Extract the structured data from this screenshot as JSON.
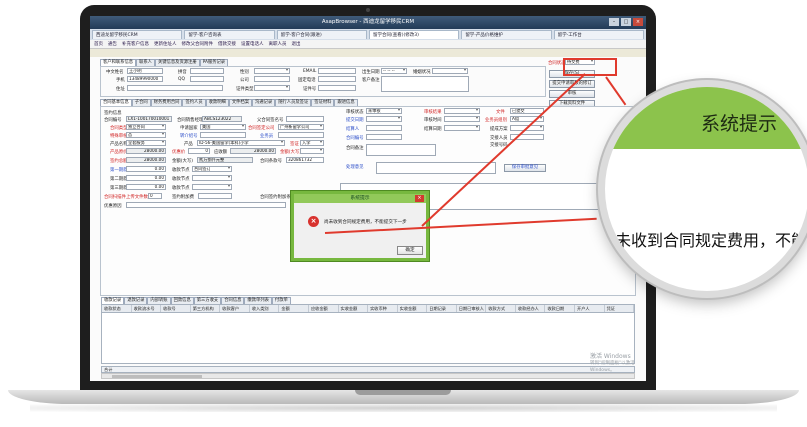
{
  "window": {
    "title": "AsapBrowser - 西迪龙留学移民CRM",
    "buttons": [
      "–",
      "□",
      "×"
    ]
  },
  "browser_tabs": [
    {
      "label": "西迪龙留学移民CRM",
      "active": false
    },
    {
      "label": "留学-客户咨询表",
      "active": false
    },
    {
      "label": "留学-客户合同(跟进)",
      "active": false
    },
    {
      "label": "留学合同(查看)(修改3)",
      "active": true
    },
    {
      "label": "留学-产品价格维护",
      "active": false
    },
    {
      "label": "留学-工作台",
      "active": false
    }
  ],
  "menu": [
    "首页",
    "通告",
    "补充客户信息",
    "更新住址人",
    "修改父合同附件",
    "借款交接",
    "设置电话人",
    "离职人员",
    "退出"
  ],
  "toolbar": [
    "客户和联系信息",
    "联系人",
    "关键信息及资源注册",
    "PA服务记录"
  ],
  "customer": {
    "name_label": "中文姓名",
    "name_value": "王小明",
    "mobile_label": "手机",
    "mobile_value": "13489990000",
    "address_label": "住址",
    "pinyin_label": "拼音",
    "qq_label": "QQ",
    "gender_label": "性别",
    "company_label": "公司",
    "cert_type_label": "证件类型",
    "email_label": "EMAIL",
    "phone_label": "固定电话",
    "cert_no_label": "证件号",
    "birth_label": "出生日期",
    "birth_value": "-- -- --",
    "marital_label": "婚姻状况",
    "remark_label": "客户备注",
    "contract_type_label": "合同状态",
    "contract_type_value": "待交费"
  },
  "right_buttons": [
    "保存(S)",
    "提交申请审核的修订",
    "审核",
    "下载资料文件"
  ],
  "contract_tabs": [
    "合同基本信息",
    "子合同",
    "财务费用合同",
    "签约人员",
    "收款明细",
    "文件档案",
    "沟通记录",
    "随行人员及签证",
    "签证材料",
    "跟进信息"
  ],
  "contract": {
    "sign_label": "签约信息",
    "no_label": "合同编号",
    "no_value": "LX1-100170010001",
    "sales_label": "合同销售经理",
    "sales_value": "ABCS123022",
    "parent_label": "父合同签名号",
    "customer_type_label": "合同类型",
    "customer_type_value": "独立合同",
    "country_label": "申请国家",
    "country_value": "美国",
    "school_label": "合同签定公司",
    "school_value": "广州新留学公司",
    "special_label": "特殊审核",
    "special_value": "否",
    "intro_label": "转介绍号",
    "product_label": "产品名称",
    "product_value": "全套服务",
    "product2_label": "产品",
    "product2_value": "ID-56-美国留学(本科)小学",
    "visa_label": "签证",
    "visa_value": "入学",
    "price_label": "产品原价",
    "price_value": "28000.00",
    "discount_label": "优惠价",
    "discount_value": "0",
    "fee_label": "应收额",
    "fee_value": "28000.00",
    "agreed_label": "签约总额",
    "agreed_value": "28000.00",
    "received_label": "金额(大写)",
    "received_value": "贰万捌仟元整",
    "rule_label": "合同条款号",
    "rule_value": "320861732",
    "first_label": "第一期款",
    "first_value": "0.00",
    "second_label": "第二期款",
    "second_value": "0.00",
    "third_label": "第三期款",
    "third_value": "0.00",
    "paynode_label": "收款节点",
    "paynode_value": "合同签订",
    "upload_label": "合同扫描件上传文件数",
    "upload_value": "0",
    "attach_label": "签约附加费",
    "remark_label": "合同签约附加条款",
    "other_label": "其他备注",
    "status_label": "审核状态",
    "status_value": "未审核",
    "audit_label": "审核结果",
    "audit_time_label": "审核时间",
    "submit_label": "提交日期",
    "settle_label": "结算人",
    "settle_date_label": "结算日期",
    "contract_no_label": "合同编号",
    "contract_remark_label": "合同备注",
    "sales_name_label": "业务员",
    "doc_label": "文件",
    "doc_value": "已提交",
    "sale_manager_label": "业务员组别",
    "sale_manager_value": "A组",
    "commission_label": "提成方案",
    "handover_label": "交接人员",
    "handover_no_label": "交接号码",
    "review_label": "处理意见",
    "review_btn": "保存审批意见",
    "extra_label": "优惠原因"
  },
  "bottom_tabs": [
    "收款记录",
    "退款记录",
    "内部转账",
    "回款信息",
    "第三方收支",
    "合同信息",
    "缴款单列表",
    "付款单"
  ],
  "grid_columns": [
    "收款状态",
    "收款流水号",
    "收款号",
    "第三方机构",
    "收款客户",
    "收入类别",
    "金额",
    "应收金额",
    "实收金额",
    "实收币种",
    "实收金额",
    "日期记录",
    "日期已审核人",
    "收款方式",
    "收款经办人",
    "收款日期",
    "开户人",
    "凭证"
  ],
  "summary_label": "合计",
  "watermark": {
    "line1": "激活 Windows",
    "line2": "转到\"控制面板\"以激活 Windows。"
  },
  "dialog": {
    "title": "系统提示",
    "message": "尚未收到合同规定费用，不能提交下一步",
    "ok_label": "确定",
    "close_label": "×"
  },
  "magnifier": {
    "title": "系统提示",
    "message": "尚未收到合同规定费用，不能"
  },
  "colors": {
    "accent_green": "#8cc34c",
    "callout_red": "#e03a2d",
    "error_red": "#d8322e"
  }
}
